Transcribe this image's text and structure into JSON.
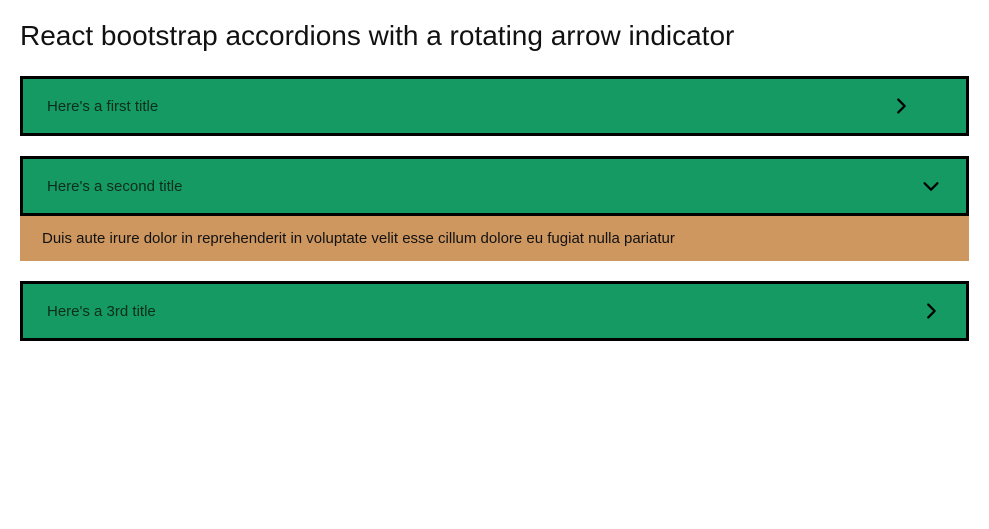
{
  "page": {
    "title": "React bootstrap accordions with a rotating arrow indicator"
  },
  "accordions": [
    {
      "title": "Here's a first title",
      "body": "",
      "expanded": false
    },
    {
      "title": "Here's a second title",
      "body": "Duis aute irure dolor in reprehenderit in voluptate velit esse cillum dolore eu fugiat nulla pariatur",
      "expanded": true
    },
    {
      "title": "Here's a 3rd title",
      "body": "",
      "expanded": false
    }
  ],
  "colors": {
    "headerBg": "#159A63",
    "bodyBg": "#CF9760",
    "border": "#000000"
  }
}
